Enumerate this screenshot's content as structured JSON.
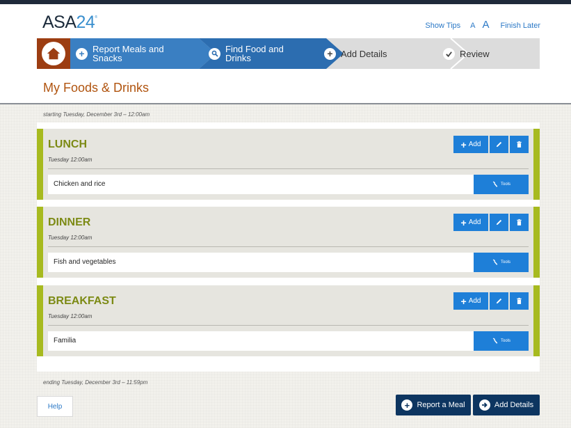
{
  "header": {
    "logo_text": "ASA",
    "logo_number": "24",
    "logo_mark": "®",
    "show_tips": "Show Tips",
    "font_small": "A",
    "font_large": "A",
    "finish_later": "Finish Later"
  },
  "nav": {
    "home_icon": "house-icon",
    "steps": [
      {
        "line1": "Report Meals and",
        "line2": "Snacks",
        "icon": "plus-icon",
        "state": "complete"
      },
      {
        "line1": "Find Food and",
        "line2": "Drinks",
        "icon": "search-icon",
        "state": "current"
      },
      {
        "line1": "Add Details",
        "line2": "",
        "icon": "plus-icon",
        "state": "todo"
      },
      {
        "line1": "Review",
        "line2": "",
        "icon": "check-icon",
        "state": "todo"
      }
    ],
    "colors": {
      "complete": "#3a7fc2",
      "current": "#2c6db0",
      "home": "#9c3d12"
    }
  },
  "page_title": "My Foods & Drinks",
  "range": {
    "start": "starting Tuesday, December 3rd – 12:00am",
    "end": "ending Tuesday, December 3rd – 11:59pm"
  },
  "meals": [
    {
      "name": "LUNCH",
      "time": "Tuesday 12:00am",
      "food": "Chicken and rice"
    },
    {
      "name": "DINNER",
      "time": "Tuesday 12:00am",
      "food": "Fish and vegetables"
    },
    {
      "name": "BREAKFAST",
      "time": "Tuesday 12:00am",
      "food": "Familia"
    }
  ],
  "meal_buttons": {
    "add": "Add",
    "tools": "Tools"
  },
  "footer": {
    "help": "Help",
    "report_meal": "Report a Meal",
    "add_details": "Add Details"
  },
  "colors": {
    "accent_blue": "#1e7fd8",
    "meal_green": "#a7ba1f",
    "title_orange": "#b0540f",
    "dark_navy": "#0d3560"
  }
}
